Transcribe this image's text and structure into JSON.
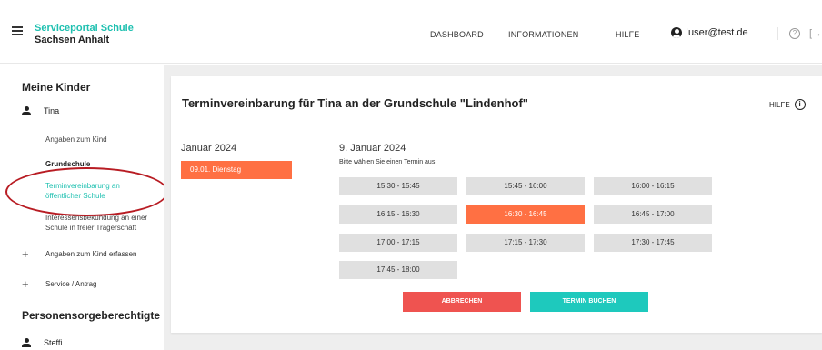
{
  "header": {
    "brand_title": "Serviceportal Schule",
    "brand_sub": "Sachsen Anhalt",
    "nav": [
      "DASHBOARD",
      "INFORMATIONEN",
      "HILFE"
    ],
    "user": "!user@test.de",
    "help_glyph": "?",
    "logout_glyph": "[→"
  },
  "sidebar": {
    "heading_children": "Meine Kinder",
    "child_name": "Tina",
    "items": [
      "Angaben zum Kind",
      "Grundschule",
      "Terminvereinbarung an öffentlicher Schule",
      "Interessensbekundung an einer Schule in freier Trägerschaft"
    ],
    "plus_items": [
      "Angaben zum Kind erfassen",
      "Service / Antrag"
    ],
    "heading_guardians": "Personensorgeberechtigte",
    "guardian_name": "Steffi"
  },
  "card": {
    "title": "Terminvereinbarung für Tina an der Grundschule \"Lindenhof\"",
    "help": "HILFE",
    "info_glyph": "i",
    "month": "Januar 2024",
    "day_chip": "09.01. Dienstag",
    "date_heading": "9. Januar 2024",
    "hint": "Bitte wählen Sie einen Termin aus.",
    "slots": [
      "15:30 - 15:45",
      "15:45 - 16:00",
      "16:00 - 16:15",
      "16:15 - 16:30",
      "16:30 - 16:45",
      "16:45 - 17:00",
      "17:00 - 17:15",
      "17:15 - 17:30",
      "17:30 - 17:45",
      "17:45 - 18:00"
    ],
    "selected_slot": "16:30 - 16:45",
    "cancel_label": "ABBRECHEN",
    "book_label": "TERMIN BUCHEN"
  },
  "colors": {
    "accent": "#1ec0b0",
    "selected": "#ff7043",
    "cancel": "#ef5350",
    "annotation": "#b81c23"
  }
}
